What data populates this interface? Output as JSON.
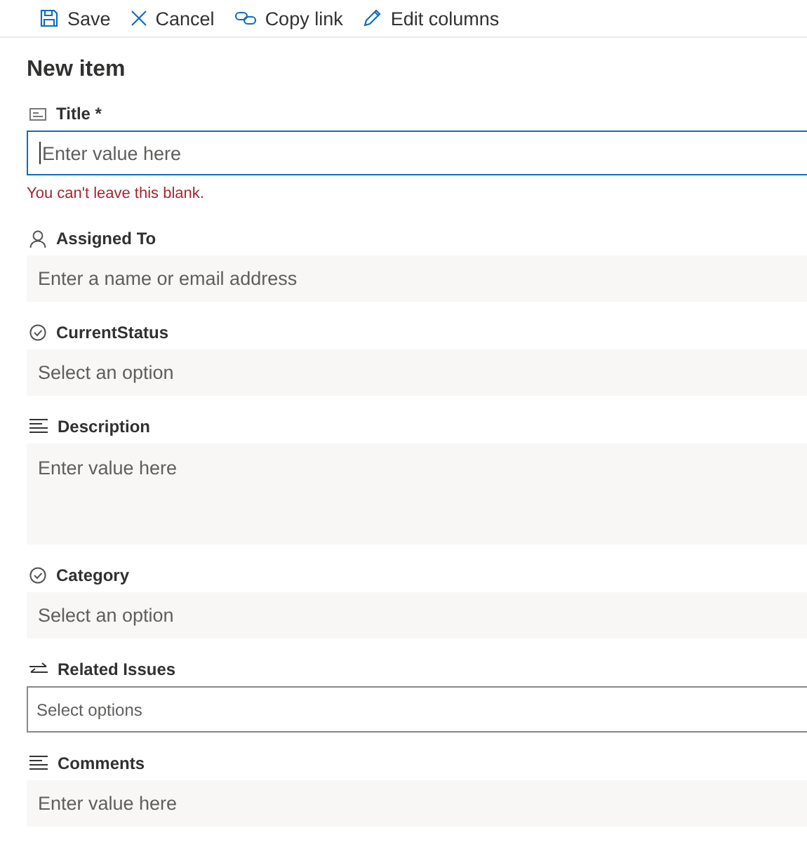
{
  "toolbar": [
    {
      "kind": "save",
      "label": "Save"
    },
    {
      "kind": "cancel",
      "label": "Cancel"
    },
    {
      "kind": "link",
      "label": "Copy link"
    },
    {
      "kind": "edit",
      "label": "Edit columns"
    }
  ],
  "heading": "New item",
  "fields": [
    {
      "kind": "text",
      "label": "Title *",
      "placeholder": "Enter value here",
      "focused": true,
      "error": "You can't leave this blank."
    },
    {
      "kind": "person",
      "label": "Assigned To",
      "placeholder": "Enter a name or email address",
      "focused": false
    },
    {
      "kind": "choice",
      "label": "CurrentStatus",
      "placeholder": "Select an option",
      "focused": false
    },
    {
      "kind": "note",
      "label": "Description",
      "placeholder": "Enter value here",
      "focused": false
    },
    {
      "kind": "choice",
      "label": "Category",
      "placeholder": "Select an option",
      "focused": false
    },
    {
      "kind": "multi",
      "label": "Related Issues",
      "placeholder": "Select options",
      "focused": false
    },
    {
      "kind": "note-short",
      "label": "Comments",
      "placeholder": "Enter value here",
      "focused": false
    }
  ]
}
